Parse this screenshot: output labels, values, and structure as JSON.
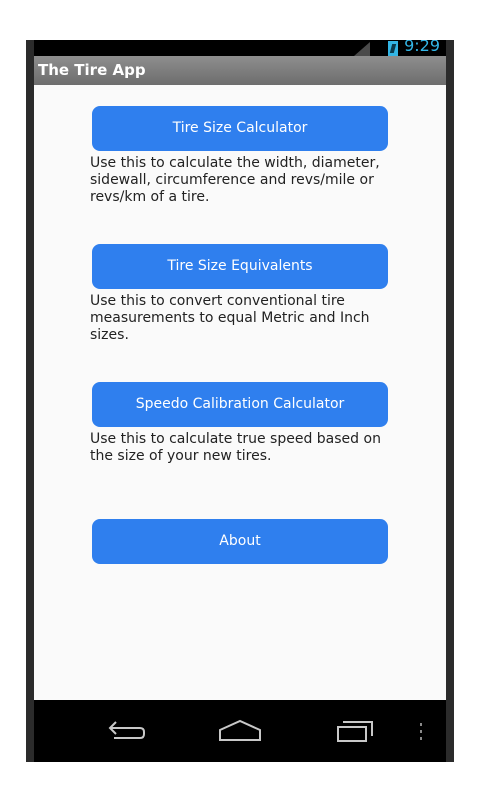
{
  "status_bar": {
    "time": "9:29",
    "icons": [
      "signal-icon",
      "battery-icon"
    ]
  },
  "action_bar": {
    "title": "The Tire App"
  },
  "main": {
    "items": [
      {
        "button_label": "Tire Size Calculator",
        "description": "Use this to calculate the width, diameter, sidewall, circumference and revs/mile or revs/km of a tire."
      },
      {
        "button_label": "Tire Size Equivalents",
        "description": "Use this to convert conventional tire measurements to equal Metric and Inch sizes."
      },
      {
        "button_label": "Speedo Calibration Calculator",
        "description": "Use this to calculate true speed based on the size of your new tires."
      }
    ],
    "about_label": "About"
  },
  "nav_bar": {
    "icons": [
      "back-icon",
      "home-icon",
      "recent-apps-icon",
      "overflow-menu-icon"
    ]
  },
  "colors": {
    "button": "#2f7fee",
    "status_accent": "#33b5e5",
    "action_bar": "#7a7a7a",
    "background": "#fafafa"
  }
}
